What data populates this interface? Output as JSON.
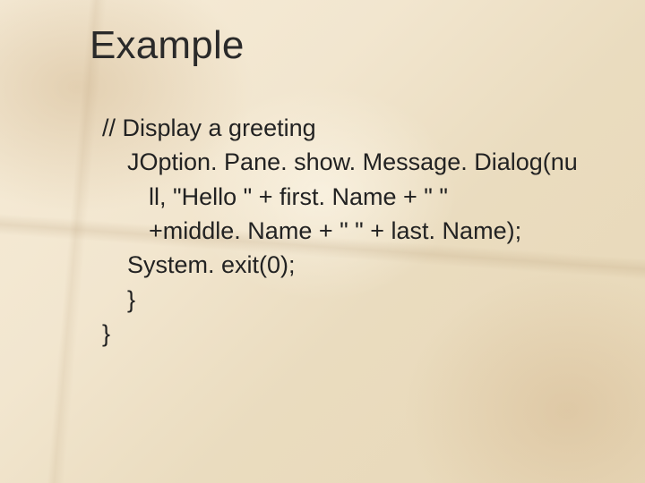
{
  "slide": {
    "title": "Example",
    "code": {
      "line1": "// Display a greeting",
      "line2": "JOption. Pane. show. Message. Dialog(nu",
      "line3": "ll, \"Hello \" + first. Name + \" \"",
      "line4": "+middle. Name + \" \" + last. Name);",
      "line5": "System. exit(0);",
      "line6": "}",
      "line7": "}"
    }
  }
}
